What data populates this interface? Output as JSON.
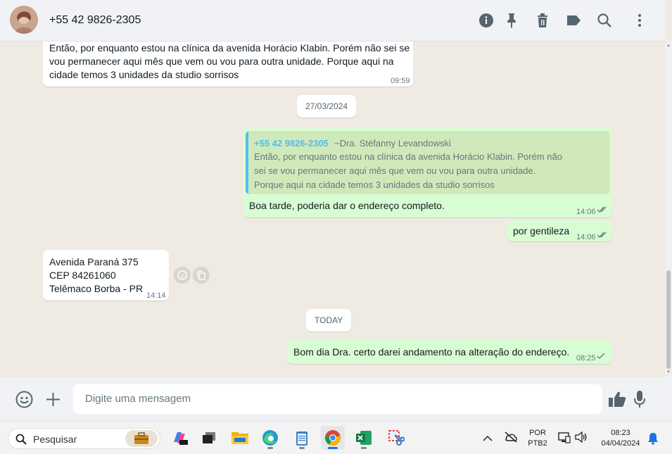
{
  "header": {
    "contact": "+55 42 9826-2305",
    "icons": [
      "info-icon",
      "pin-icon",
      "delete-icon",
      "label-icon",
      "search-icon",
      "menu-icon"
    ]
  },
  "chat": {
    "messages": [
      {
        "direction": "in",
        "text_lines": [
          "Então, por enquanto estou na clínica da avenida Horácio Klabin. Porém não sei se",
          "vou permanecer aqui mês que vem ou vou para outra unidade. Porque aqui na",
          "cidade temos 3 unidades da studio sorrisos"
        ],
        "time": "09:59"
      },
      {
        "type": "date",
        "label": "27/03/2024"
      },
      {
        "direction": "out",
        "quote": {
          "author": "+55 42 9826-2305",
          "author_name": "~Dra. Stéfanny Levandowski",
          "text_lines": [
            "Então, por enquanto estou na clínica da avenida Horácio Klabin. Porém não",
            "sei se vou permanecer aqui mês que vem ou vou para outra unidade.",
            "Porque aqui na cidade temos 3 unidades da studio sorrisos"
          ]
        },
        "text": "Boa tarde, poderia dar o endereço completo.",
        "time": "14:06",
        "status": "read"
      },
      {
        "direction": "out",
        "text": "por gentileza",
        "time": "14:06",
        "status": "read"
      },
      {
        "direction": "in",
        "text_lines": [
          "Avenida Paraná 375",
          "CEP 84261060",
          "Telêmaco Borba - PR"
        ],
        "time": "14:14"
      },
      {
        "type": "date",
        "label": "TODAY"
      },
      {
        "direction": "out",
        "text": "Bom dia Dra. certo darei andamento na alteração do endereço.",
        "time": "08:25",
        "status": "sent"
      }
    ]
  },
  "composer": {
    "placeholder": "Digite uma mensagem"
  },
  "taskbar": {
    "search_placeholder": "Pesquisar",
    "lang_top": "POR",
    "lang_bottom": "PTB2",
    "clock_time": "08:23",
    "clock_date": "04/04/2024"
  },
  "colors": {
    "chat_bg": "#efeae2",
    "outgoing_bubble": "#d9fdd3",
    "incoming_bubble": "#ffffff",
    "read_ticks": "#667781",
    "quote_accent": "#53bdeb"
  }
}
